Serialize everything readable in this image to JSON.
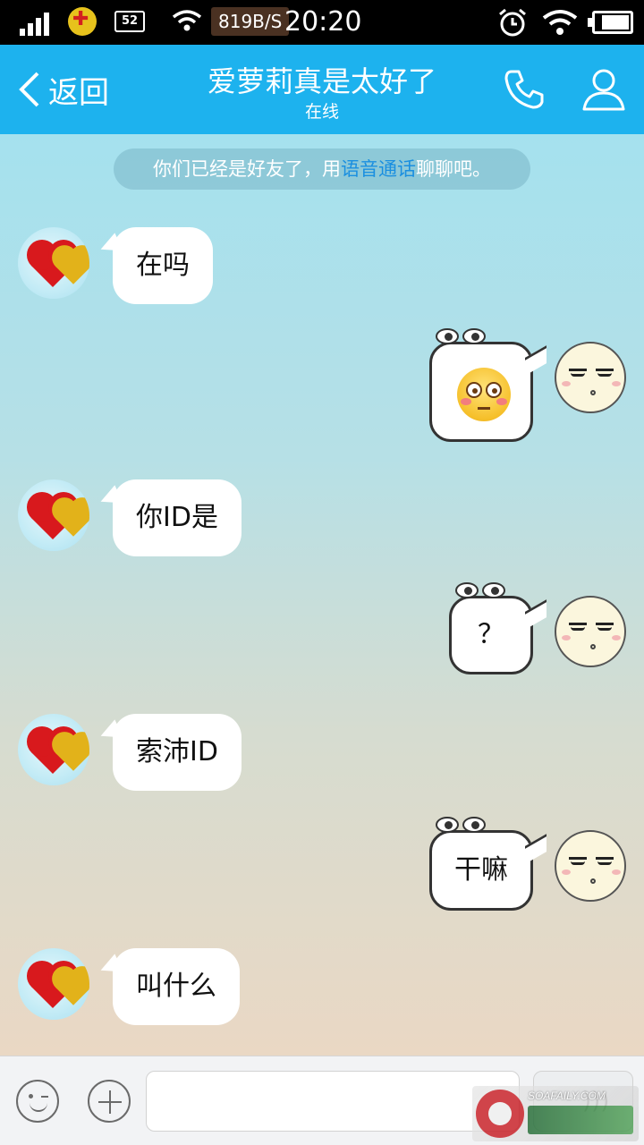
{
  "status_bar": {
    "network_speed": "819B/S",
    "time": "20:20",
    "badge_label": "52"
  },
  "header": {
    "back_label": "返回",
    "title": "爱萝莉真是太好了",
    "subtitle": "在线"
  },
  "system_notice": {
    "prefix": "你们已经是好友了，用",
    "link": "语音通话",
    "suffix": "聊聊吧。"
  },
  "messages": [
    {
      "side": "left",
      "text": "在吗"
    },
    {
      "side": "right",
      "kind": "emoji",
      "emoji_name": "flushed-face-emoji"
    },
    {
      "side": "left",
      "text": "你ID是"
    },
    {
      "side": "right",
      "text": "？"
    },
    {
      "side": "left",
      "text": "索沛ID"
    },
    {
      "side": "right",
      "text": "干嘛"
    },
    {
      "side": "left",
      "text": "叫什么"
    }
  ],
  "input_bar": {
    "placeholder": "",
    "value": ""
  },
  "watermark": {
    "text": "SOAFAILY.COM"
  },
  "colors": {
    "header_bg": "#1db2ee",
    "link": "#1a8fe0",
    "bubble_left": "#ffffff",
    "bubble_right_border": "#333333"
  },
  "icons": {
    "signal": "signal-bars-icon",
    "wifi": "wifi-icon",
    "alarm": "alarm-clock-icon",
    "battery": "battery-icon",
    "back": "chevron-left-icon",
    "call": "phone-icon",
    "profile": "person-icon",
    "emoji_button": "smiley-icon",
    "plus_button": "plus-circle-icon",
    "voice": "voice-wave-icon"
  }
}
